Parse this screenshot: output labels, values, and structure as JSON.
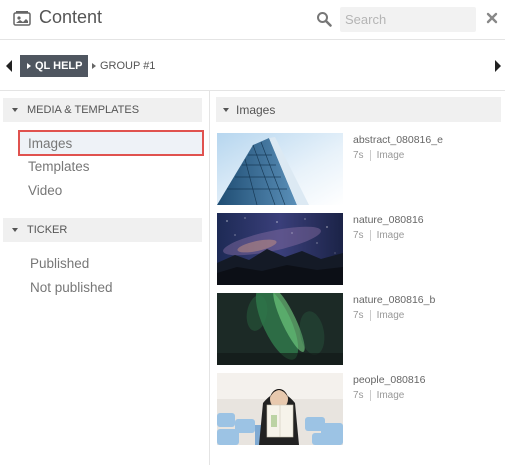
{
  "header": {
    "title": "Content",
    "search_placeholder": "Search",
    "icons": [
      "content-icon",
      "search-icon",
      "close-icon"
    ]
  },
  "groupbar": {
    "active_group": "QL HELP",
    "other_group": "GROUP #1",
    "icons": [
      "nav-left-arrow-icon",
      "nav-right-arrow-icon"
    ]
  },
  "sidebar": {
    "sections": [
      {
        "title": "MEDIA & TEMPLATES",
        "items": [
          "Images",
          "Templates",
          "Video"
        ],
        "active": "Images"
      },
      {
        "title": "TICKER",
        "items": [
          "Published",
          "Not published"
        ]
      }
    ]
  },
  "main": {
    "section_title": "Images",
    "items": [
      {
        "name": "abstract_080816_e",
        "duration": "7s",
        "type": "Image",
        "thumb": "building"
      },
      {
        "name": "nature_080816",
        "duration": "7s",
        "type": "Image",
        "thumb": "milky-way"
      },
      {
        "name": "nature_080816_b",
        "duration": "7s",
        "type": "Image",
        "thumb": "aurora"
      },
      {
        "name": "people_080816",
        "duration": "7s",
        "type": "Image",
        "thumb": "person-reading"
      }
    ]
  },
  "colors": {
    "active_group_bg": "#4f5660",
    "active_highlight_border": "#e0524f",
    "section_bg": "#f0f0f0"
  }
}
